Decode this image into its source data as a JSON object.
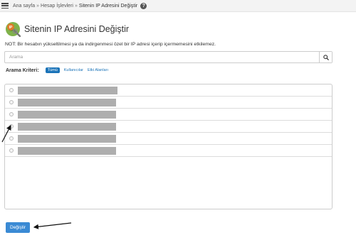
{
  "breadcrumb": {
    "items": [
      "Ana sayfa",
      "Hesap İşlevleri"
    ],
    "separator": "»",
    "current": "Sitenin IP Adresini Değiştir",
    "help_icon": "question-circle-icon"
  },
  "page": {
    "title": "Sitenin IP Adresini Değiştir",
    "icon": "ip-address-icon",
    "note": "NOT: Bir hesabın yükseltilmesi ya da indirgenmesi özel bir IP adresi içerip içermemesini etkilemez."
  },
  "search": {
    "placeholder": "Arama",
    "value": "",
    "icon": "search-icon"
  },
  "filter": {
    "label": "Arama Kriteri:",
    "options": [
      "Tümü",
      "Kullanıcılar",
      "Etki Alanları"
    ],
    "selected": "Tümü"
  },
  "list": {
    "row_count": 6,
    "rows": [
      "[redacted]",
      "[redacted]",
      "[redacted]",
      "[redacted]",
      "[redacted]",
      "[redacted]"
    ]
  },
  "actions": {
    "submit_label": "Değiştir"
  },
  "colors": {
    "accent": "#1a73b8",
    "button": "#3a8ad4",
    "redaction": "#aeaeae"
  }
}
